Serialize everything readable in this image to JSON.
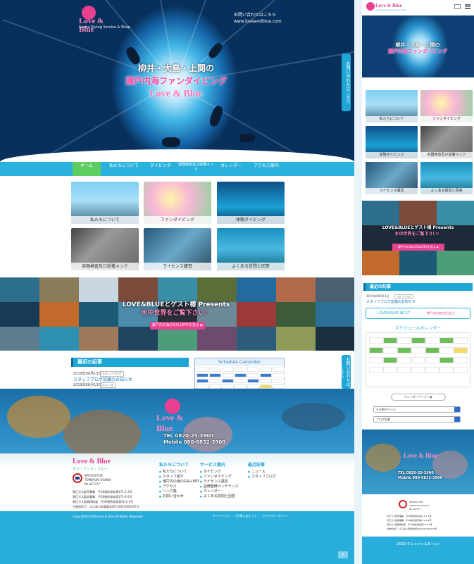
{
  "desktop": {
    "hero": {
      "logo_text": "Love & Blue",
      "logo_sub": "Scuba Diving Service & Shop",
      "contact": "お問い合わせはこちら",
      "url": "www.loveandblue.com",
      "title_line1": "柳井・大島・上関の",
      "title_line2": "瀬戸内海ファンダイビング",
      "title_line3": "Love & Blue",
      "side_tab": "お問い合わせはこちら"
    },
    "nav": [
      "ホーム",
      "私たちについて",
      "ダイビング",
      "容器検査及び設備メンテ",
      "カレンダー",
      "アクセス案内"
    ],
    "tiles": [
      "私たちについて",
      "ファンダイビング",
      "体験ダイビング",
      "容器検査及び設備メンテ",
      "ライセンス講習",
      "よくある質問と回答"
    ],
    "gallery": {
      "title1": "LOVE&BLUEとゲスト様 Presents",
      "title2": "水中世界をご覧下さい！",
      "button": "瀬戸内の海のGALLERYを見る ▶"
    },
    "recent": {
      "heading": "最近の記事",
      "posts": [
        {
          "date": "2019年06月13日",
          "tag": "スタッフブログ",
          "title": "スタッフブログ認識のお知らせ"
        },
        {
          "date": "2019年06月13日",
          "tag": "ニュース",
          "title": ""
        }
      ]
    },
    "schedule": {
      "title": "Schedule Carrender"
    },
    "footer_photo": {
      "logo": "Love & Blue",
      "tel": "TEL 0820-25-3900",
      "mobile": "Mobile 080-6832-3900"
    },
    "footer": {
      "logo": "Love & Blue",
      "sub": "ラブ・アンド・ブルー",
      "instructor": [
        "INSTRUCTOR",
        "TOMOYUKI OGAWA",
        "No.427377"
      ],
      "licenses": [
        "高圧ガス販売事業　平28物防保安第171-2-3号",
        "高圧ガス製造事業　平28物防保安第171-6-2号",
        "高圧ガス容器再検査　平28物防保安第22-1-5号",
        "古物商許可　山口県公安委員会第741041000207号"
      ],
      "col_about": {
        "heading": "私たちについて",
        "items": [
          "私たちについて",
          "スタッフ紹介",
          "瀬戸内の海のGALLERY",
          "アクセス",
          "リンク集",
          "お問い合わせ"
        ]
      },
      "col_service": {
        "heading": "サービス案内",
        "items": [
          "ダイビング",
          "ファンダイビング",
          "ライセンス講習",
          "設備整備メンテナンス",
          "カレンダー",
          "よくある質問と回答"
        ]
      },
      "col_recent": {
        "heading": "最近記事",
        "items": [
          "ニュース",
          "スタッフブログ"
        ]
      },
      "copyright": "Copyright©2019 Love & Blue All Rights Reserved.",
      "bottom_links": "サイトマップ  ｜ ご利用にあたって ｜ プライバシーポリシー"
    },
    "totop": "↑"
  },
  "mobile": {
    "logo_text": "Love & Blue",
    "logo_sub": "Scuba Diving Service & Shop",
    "hero_line1": "柳井・大島・上関の",
    "hero_line2": "瀬戸内海ファンダイビング",
    "tiles": [
      "私たちについて",
      "ファンダイビング",
      "体験ダイビング",
      "容器検査及び設備メンテ",
      "ライセンス講習",
      "よくある質問と回答"
    ],
    "gallery": {
      "title1": "LOVE&BLUEとゲスト様 Presents",
      "title2": "水中世界をご覧下さい！",
      "button": "瀬戸内の海のGALLERYを見る ▶"
    },
    "recent": {
      "heading": "最近の記事",
      "posts": [
        {
          "date": "2019年06月13日",
          "tag": "スタッフブログ",
          "title": "スタッフブログ認識のお知らせ"
        }
      ]
    },
    "banner": {
      "left": "LOVE&BLUE 海ログ",
      "right": "瀬戸内の海を振り返り"
    },
    "calendar": {
      "heading": "スケジュールカレンダー",
      "button": "カレンダーページへ ▶"
    },
    "selects": [
      "その他のページ",
      "ブログ記事"
    ],
    "footer": {
      "logo": "Love & Blue",
      "tel": "TEL 0820-25-3900",
      "mobile": "Mobile 080-6832-3900",
      "instructor": [
        "INSTRUCTOR",
        "TOMOYUKI OGAWA",
        "No.427377"
      ],
      "licenses": [
        "高圧ガス販売事業　平28物防保安第171-2-3号",
        "高圧ガス製造事業　平28物防保安第171-6-2号",
        "高圧ガス容器再検査　平28物防保安第22-1-5号",
        "古物商許可　山口県公安委員会第741041000207号"
      ],
      "copyright": "2019 © L o v e & B l u e"
    }
  }
}
